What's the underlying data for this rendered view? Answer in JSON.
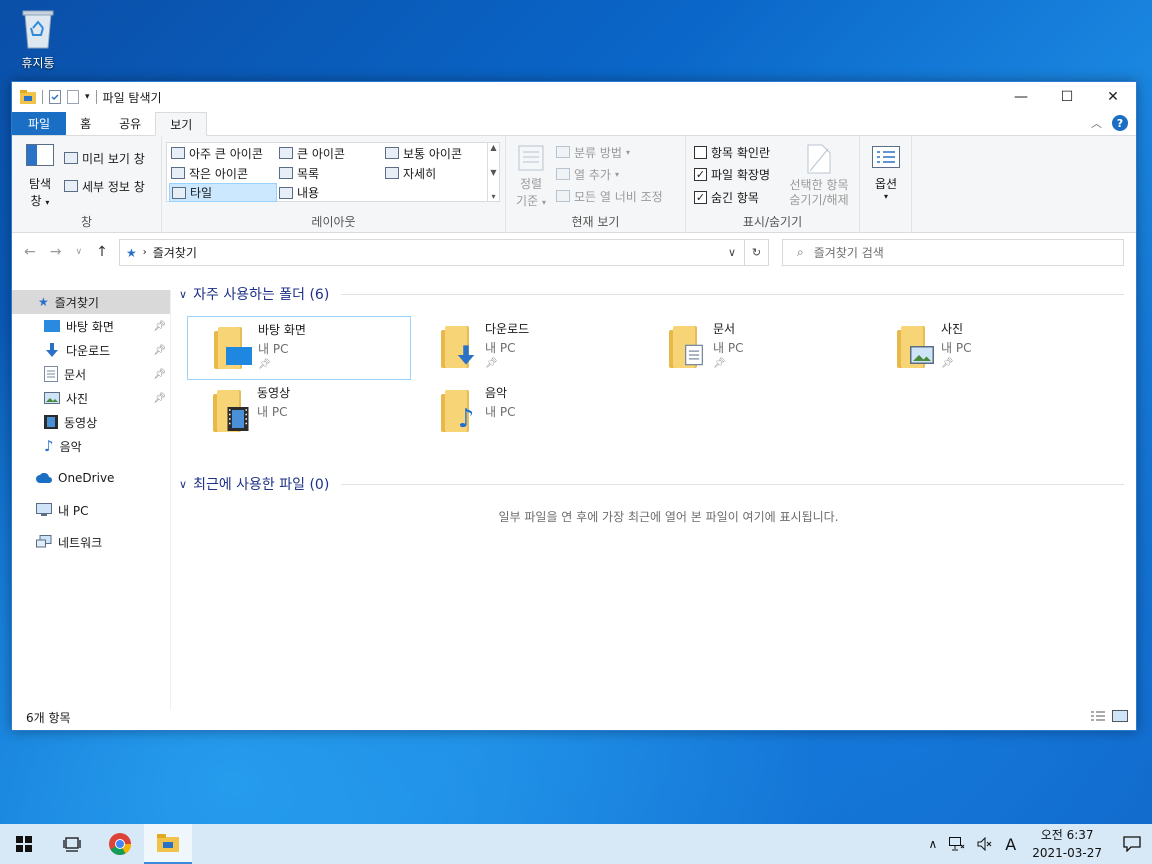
{
  "desktop": {
    "recycle_bin_label": "휴지통"
  },
  "window": {
    "title": "파일 탐색기",
    "controls": {
      "minimize": "—",
      "maximize": "☐",
      "close": "✕"
    }
  },
  "ribbon_tabs": [
    "파일",
    "홈",
    "공유",
    "보기"
  ],
  "ribbon": {
    "pane_group": {
      "label": "창",
      "nav_pane_line1": "탐색",
      "nav_pane_line2": "창",
      "preview_pane": "미리 보기 창",
      "details_pane": "세부 정보 창"
    },
    "layout_group": {
      "label": "레이아웃",
      "items": [
        "아주 큰 아이콘",
        "큰 아이콘",
        "보통 아이콘",
        "작은 아이콘",
        "목록",
        "자세히",
        "타일",
        "내용"
      ]
    },
    "current_view_group": {
      "label": "현재 보기",
      "sort_line1": "정렬",
      "sort_line2": "기준",
      "group_by": "분류 방법",
      "add_columns": "열 추가",
      "fit_columns": "모든 열 너비 조정"
    },
    "show_hide_group": {
      "label": "표시/숨기기",
      "item_checkboxes": "항목 확인란",
      "file_extensions": "파일 확장명",
      "hidden_items": "숨긴 항목",
      "hide_selected_line1": "선택한 항목",
      "hide_selected_line2": "숨기기/해제"
    },
    "options": {
      "label": "옵션"
    }
  },
  "address_bar": {
    "path": "즐겨찾기",
    "search_placeholder": "즐겨찾기 검색"
  },
  "sidebar": {
    "quick_access": "즐겨찾기",
    "pinned": [
      "바탕 화면",
      "다운로드",
      "문서",
      "사진"
    ],
    "unpinned": [
      "동영상",
      "음악"
    ],
    "onedrive": "OneDrive",
    "this_pc": "내 PC",
    "network": "네트워크"
  },
  "content": {
    "frequent_header": "자주 사용하는 폴더 (6)",
    "recent_header": "최근에 사용한 파일 (0)",
    "empty_message": "일부 파일을 연 후에 가장 최근에 열어 본 파일이 여기에 표시됩니다.",
    "folders": [
      {
        "name": "바탕 화면",
        "location": "내 PC"
      },
      {
        "name": "다운로드",
        "location": "내 PC"
      },
      {
        "name": "문서",
        "location": "내 PC"
      },
      {
        "name": "사진",
        "location": "내 PC"
      },
      {
        "name": "동영상",
        "location": "내 PC"
      },
      {
        "name": "음악",
        "location": "내 PC"
      }
    ]
  },
  "status": {
    "item_count": "6개 항목"
  },
  "taskbar": {
    "ime_indicator": "A",
    "clock_time": "오전 6:37",
    "clock_date": "2021-03-27"
  },
  "colors": {
    "accent": "#1a6fc4",
    "folder": "#f7d475",
    "selection": "#cce8ff"
  }
}
